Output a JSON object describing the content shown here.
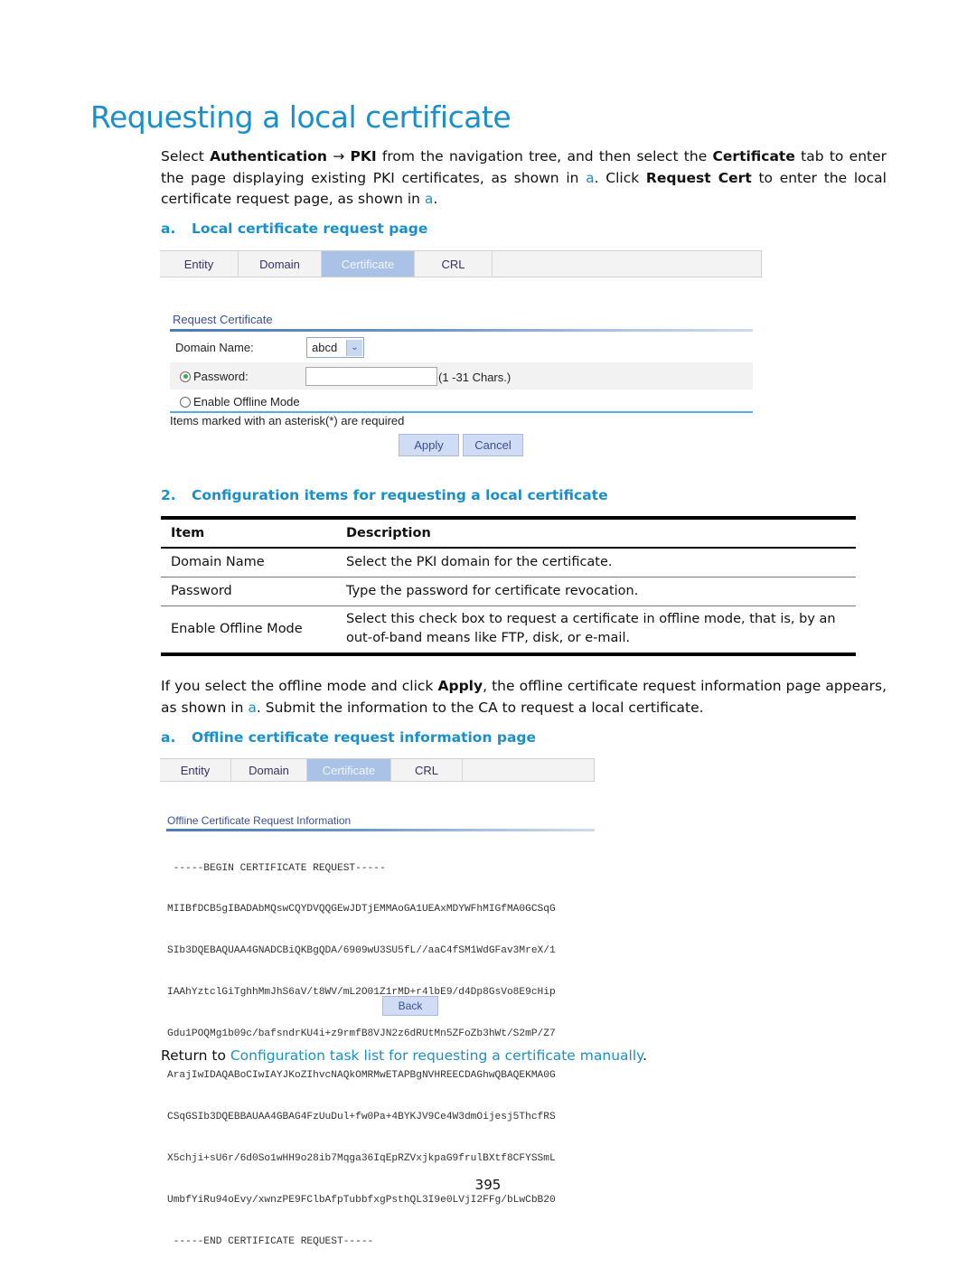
{
  "heading": "Requesting a local certificate",
  "intro": {
    "t1": "Select ",
    "b1": "Authentication",
    "arrow": " → ",
    "b2": "PKI",
    "t2": " from the navigation tree, and then select the ",
    "b3": "Certificate",
    "t3": " tab to enter the page displaying existing PKI certificates, as shown in ",
    "ref1": "a",
    "t4": ". Click ",
    "b4": "Request Cert",
    "t5": " to enter the local certificate request page, as shown in ",
    "ref2": "a",
    "t6": "."
  },
  "figure1": {
    "num": "a.",
    "caption": "Local certificate request page",
    "tabs": [
      "Entity",
      "Domain",
      "Certificate",
      "CRL"
    ],
    "active_tab": "Certificate",
    "section_title": "Request Certificate",
    "domain_label": "Domain Name:",
    "domain_value": "abcd",
    "password_label": "Password:",
    "password_value": "",
    "password_hint": "(1 -31 Chars.)",
    "offline_label": "Enable Offline Mode",
    "selected_option": "Password",
    "required_note": "Items marked with an asterisk(*) are required",
    "apply": "Apply",
    "cancel": "Cancel"
  },
  "table": {
    "num": "2.",
    "caption": "Configuration items for requesting a local certificate",
    "headers": [
      "Item",
      "Description"
    ],
    "rows": [
      {
        "item": "Domain Name",
        "desc": "Select the PKI domain for the certificate."
      },
      {
        "item": "Password",
        "desc": "Type the password for certificate revocation."
      },
      {
        "item": "Enable Offline Mode",
        "desc1": "Select this check box to request a certificate in offline mode, that is, by an",
        "desc2": "out-of-band means like FTP, disk, or e-mail."
      }
    ]
  },
  "offline_para": {
    "t1": "If you select the offline mode and click ",
    "b1": "Apply",
    "t2": ", the offline certificate request information page appears, as shown in ",
    "ref": "a",
    "t3": ". Submit the information to the CA to request a local certificate."
  },
  "figure2": {
    "num": "a.",
    "caption": "Offline certificate request information page",
    "tabs": [
      "Entity",
      "Domain",
      "Certificate",
      "CRL"
    ],
    "active_tab": "Certificate",
    "section_title": "Offline Certificate Request Information",
    "cert_lines": [
      " -----BEGIN CERTIFICATE REQUEST-----",
      "MIIBfDCB5gIBADAbMQswCQYDVQQGEwJDTjEMMAoGA1UEAxMDYWFhMIGfMA0GCSqG",
      "SIb3DQEBAQUAA4GNADCBiQKBgQDA/6909wU3SU5fL//aaC4fSM1WdGFav3MreX/1",
      "IAAhYztclGiTghhMmJhS6aV/t8WV/mL2O01Z1rMD+r4lbE9/d4Dp8GsVo8E9cHip",
      "Gdu1POQMg1b09c/bafsndrKU4i+z9rmfB8VJN2z6dRUtMn5ZFoZb3hWt/S2mP/Z7",
      "ArajIwIDAQABoCIwIAYJKoZIhvcNAQkOMRMwETAPBgNVHREECDAGhwQBAQEKMA0G",
      "CSqGSIb3DQEBBAUAA4GBAG4FzUuDul+fw0Pa+4BYKJV9Ce4W3dmOijesj5ThcfRS",
      "X5chji+sU6r/6d0So1wHH9o28ib7Mqga36IqEpRZVxjkpaG9frulBXtf8CFYSSmL",
      "UmbfYiRu94oEvy/xwnzPE9FClbAfpTubbfxgPsthQL3I9e0LVjI2FFg/bLwCbB20",
      " -----END CERTIFICATE REQUEST-----"
    ],
    "back": "Back"
  },
  "return": {
    "t1": "Return to ",
    "link": "Configuration task list for requesting a certificate manually",
    "t2": "."
  },
  "page_number": "395"
}
